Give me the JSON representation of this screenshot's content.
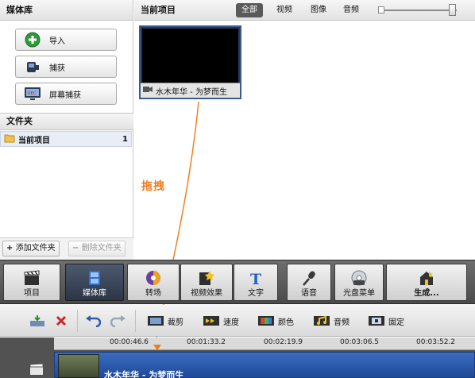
{
  "media_panel": {
    "title": "媒体库",
    "buttons": [
      {
        "label": "导入",
        "icon": "add-icon"
      },
      {
        "label": "捕获",
        "icon": "camcorder-icon"
      },
      {
        "label": "屏幕捕获",
        "icon": "screen-record-icon"
      }
    ]
  },
  "folders": {
    "title": "文件夹",
    "items": [
      {
        "label": "当前项目",
        "count": "1",
        "icon": "folder-icon"
      }
    ],
    "add_button": "添加文件夹",
    "delete_button": "删除文件夹"
  },
  "project": {
    "title": "当前项目",
    "filters": [
      "全部",
      "视频",
      "图像",
      "音频"
    ],
    "active_filter": "全部",
    "clips": [
      {
        "name": "水木年华 - 为梦而生",
        "type_icon": "video-icon"
      }
    ]
  },
  "drag_hint": "拖拽",
  "main_toolbar": {
    "items": [
      {
        "label": "项目",
        "icon": "clapper-icon"
      },
      {
        "label": "媒体库",
        "icon": "film-strip-icon",
        "active": true
      },
      {
        "label": "转场",
        "icon": "transition-icon"
      },
      {
        "label": "视频效果",
        "icon": "effects-icon"
      },
      {
        "label": "文字",
        "icon": "text-icon"
      },
      {
        "label": "语音",
        "icon": "microphone-icon"
      },
      {
        "label": "光盘菜单",
        "icon": "disc-icon"
      },
      {
        "label": "生成...",
        "icon": "export-icon"
      }
    ]
  },
  "edit_toolbar": {
    "items": [
      {
        "label": "裁剪",
        "icon": "crop-icon"
      },
      {
        "label": "速度",
        "icon": "speed-icon"
      },
      {
        "label": "颜色",
        "icon": "color-icon"
      },
      {
        "label": "音频",
        "icon": "audio-icon"
      },
      {
        "label": "固定",
        "icon": "freeze-icon"
      }
    ]
  },
  "timeline": {
    "ticks": [
      "00:00:46.6",
      "00:01:33.2",
      "00:02:19.9",
      "00:03:06.5",
      "00:03:52.2"
    ],
    "clip_title": "水木年华 - 为梦而生"
  },
  "colors": {
    "accent_orange": "#f07a1a",
    "clip_blue": "#2b5aa8",
    "toolbar_dark": "#555555"
  }
}
